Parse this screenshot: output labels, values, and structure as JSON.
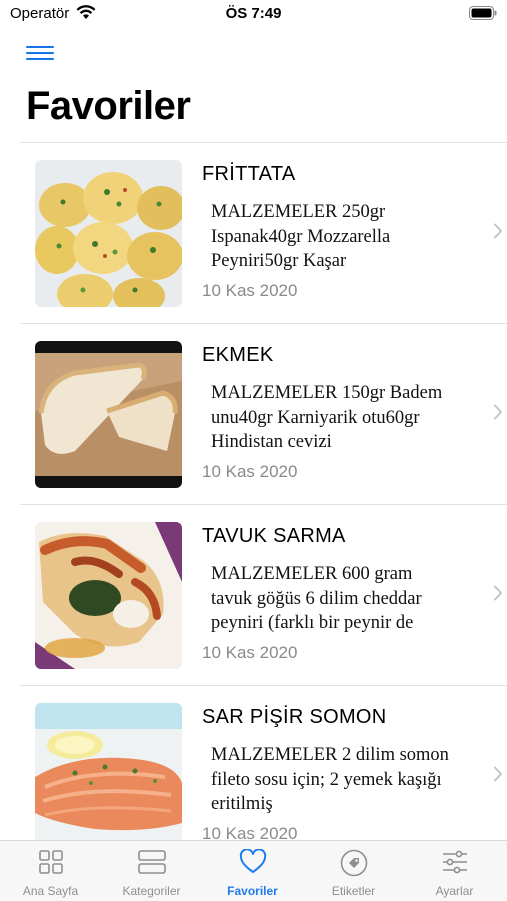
{
  "status_bar": {
    "carrier": "Operatör",
    "time": "ÖS 7:49"
  },
  "header": {
    "title": "Favoriler"
  },
  "recipes": [
    {
      "title": "FRİTTATA",
      "description": "MALZEMELER 250gr Ispanak40gr Mozzarella Peyniri50gr Kaşar",
      "date": "10 Kas 2020",
      "image": "frittata-muffins"
    },
    {
      "title": "EKMEK",
      "description": "MALZEMELER 150gr Badem unu40gr Karniyarik otu60gr Hindistan cevizi",
      "date": "10 Kas 2020",
      "image": "bread-slices"
    },
    {
      "title": "TAVUK SARMA",
      "description": "MALZEMELER 600 gram tavuk göğüs 6 dilim cheddar peyniri (farklı bir peynir de",
      "date": "10 Kas 2020",
      "image": "chicken-roll"
    },
    {
      "title": "SAR PİŞİR SOMON",
      "description": "MALZEMELER 2 dilim somon fileto sosu için; 2 yemek kaşığı eritilmiş",
      "date": "10 Kas 2020",
      "image": "salmon-fillet"
    }
  ],
  "tabs": [
    {
      "label": "Ana Sayfa",
      "icon": "grid-icon",
      "active": false
    },
    {
      "label": "Kategoriler",
      "icon": "stack-icon",
      "active": false
    },
    {
      "label": "Favoriler",
      "icon": "heart-icon",
      "active": true
    },
    {
      "label": "Etiketler",
      "icon": "tag-icon",
      "active": false
    },
    {
      "label": "Ayarlar",
      "icon": "sliders-icon",
      "active": false
    }
  ],
  "colors": {
    "accent": "#1f7bf0",
    "inactive": "#8e8e93",
    "date": "#8a8a8e"
  }
}
